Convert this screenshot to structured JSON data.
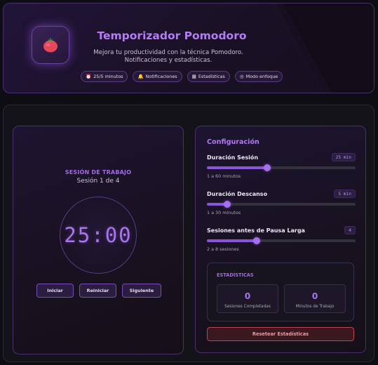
{
  "header": {
    "title": "Temporizador Pomodoro",
    "subtitle_line1": "Mejora tu productividad con la técnica Pomodoro.",
    "subtitle_line2": "Notificaciones y estadísticas.",
    "logo_icon": "tomato-icon",
    "badges": [
      {
        "icon": "alarm-icon",
        "glyph": "⏰",
        "label": "25/5 minutos"
      },
      {
        "icon": "bell-icon",
        "glyph": "🔔",
        "label": "Notificaciones"
      },
      {
        "icon": "bar-chart-icon",
        "glyph": "▦",
        "label": "Estadísticas"
      },
      {
        "icon": "target-icon",
        "glyph": "◎",
        "label": "Modo enfoque"
      }
    ]
  },
  "timer": {
    "session_label": "SESIÓN DE TRABAJO",
    "session_count": "Sesión 1 de 4",
    "time": "25:00",
    "buttons": {
      "start": "Iniciar",
      "reset": "Reiniciar",
      "next": "Siguiente"
    }
  },
  "config": {
    "title": "Configuración",
    "settings": [
      {
        "label": "Duración Sesión",
        "value": "25 min",
        "range": "1 a 60 minutos",
        "min": 1,
        "max": 60,
        "current": 25
      },
      {
        "label": "Duración Descanso",
        "value": "5 min",
        "range": "1 a 30 minutos",
        "min": 1,
        "max": 30,
        "current": 5
      },
      {
        "label": "Sesiones antes de Pausa Larga",
        "value": "4",
        "range": "2 a 8 sesiones",
        "min": 2,
        "max": 8,
        "current": 4
      }
    ],
    "stats": {
      "title": "ESTADÍSTICAS",
      "completed_value": "0",
      "completed_label": "Sesiones Completadas",
      "minutes_value": "0",
      "minutes_label": "Minutos de Trabajo"
    },
    "reset_stats_label": "Resetear Estadísticas"
  },
  "colors": {
    "accent": "#a874f2",
    "danger": "#c0424f",
    "background": "#0d0d13"
  }
}
